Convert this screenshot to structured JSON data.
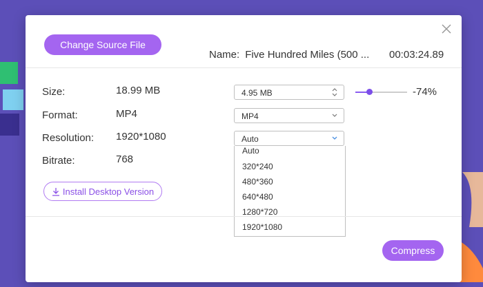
{
  "modal": {
    "change_source_label": "Change Source File",
    "name_label": "Name:",
    "file_name": "Five Hundred Miles (500 ...",
    "duration": "00:03:24.89"
  },
  "info": {
    "size_label": "Size:",
    "size_value": "18.99 MB",
    "format_label": "Format:",
    "format_value": "MP4",
    "resolution_label": "Resolution:",
    "resolution_value": "1920*1080",
    "bitrate_label": "Bitrate:",
    "bitrate_value": "768"
  },
  "controls": {
    "target_size": "4.95  MB",
    "compression_percent": "-74%",
    "slider_level": 0.26,
    "format_selected": "MP4",
    "resolution_selected": "Auto",
    "resolution_options": [
      "Auto",
      "320*240",
      "480*360",
      "640*480",
      "1280*720",
      "1920*1080"
    ]
  },
  "install_label": "Install Desktop Version",
  "compress_label": "Compress",
  "colors": {
    "accent": "#a465f0",
    "background": "#5c4fb8",
    "dropdown_chevron": "#4a90e2"
  },
  "icons": {
    "close": "close-icon",
    "stepper": "up-down-chevron-icon",
    "dropdown": "chevron-down-icon",
    "download": "download-icon"
  }
}
